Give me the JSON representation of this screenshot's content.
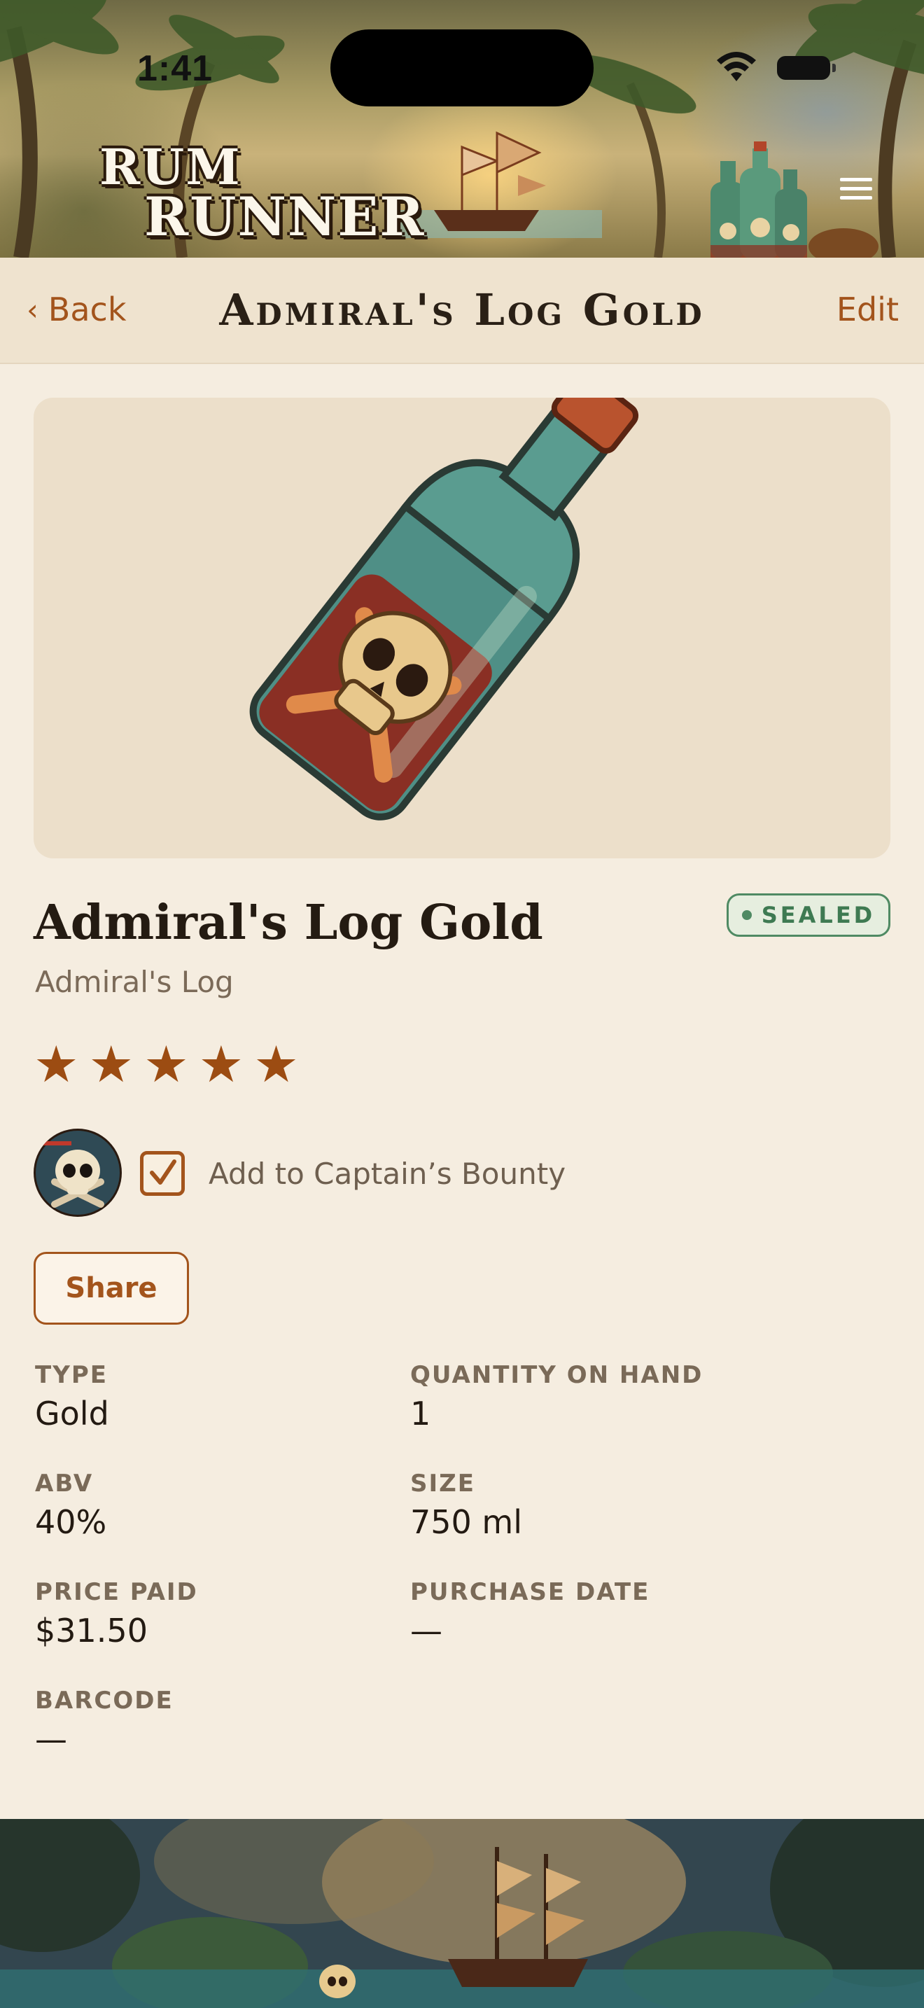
{
  "status_bar": {
    "time": "1:41"
  },
  "header": {
    "logo_line1": "RUM",
    "logo_line2": "RUNNER",
    "menu_icon": "hamburger-menu-icon"
  },
  "nav": {
    "back_label": "Back",
    "title": "Admiral's Log Gold",
    "edit_label": "Edit"
  },
  "product": {
    "name": "Admiral's Log Gold",
    "brand": "Admiral's Log",
    "status_badge": "SEALED",
    "rating": 5,
    "rating_max": 5,
    "bounty_checked": true,
    "bounty_label": "Add to Captain’s Bounty",
    "share_label": "Share"
  },
  "details": {
    "type": {
      "label": "TYPE",
      "value": "Gold"
    },
    "quantity": {
      "label": "QUANTITY ON HAND",
      "value": "1"
    },
    "abv": {
      "label": "ABV",
      "value": "40%"
    },
    "size": {
      "label": "SIZE",
      "value": "750 ml"
    },
    "price": {
      "label": "PRICE PAID",
      "value": "$31.50"
    },
    "purchase_date": {
      "label": "PURCHASE DATE",
      "value": "—"
    },
    "barcode": {
      "label": "BARCODE",
      "value": "—"
    }
  },
  "colors": {
    "accent": "#a3541c",
    "background": "#f5ede0",
    "sealed_green": "#4f8a63",
    "star": "#9c4c12"
  }
}
